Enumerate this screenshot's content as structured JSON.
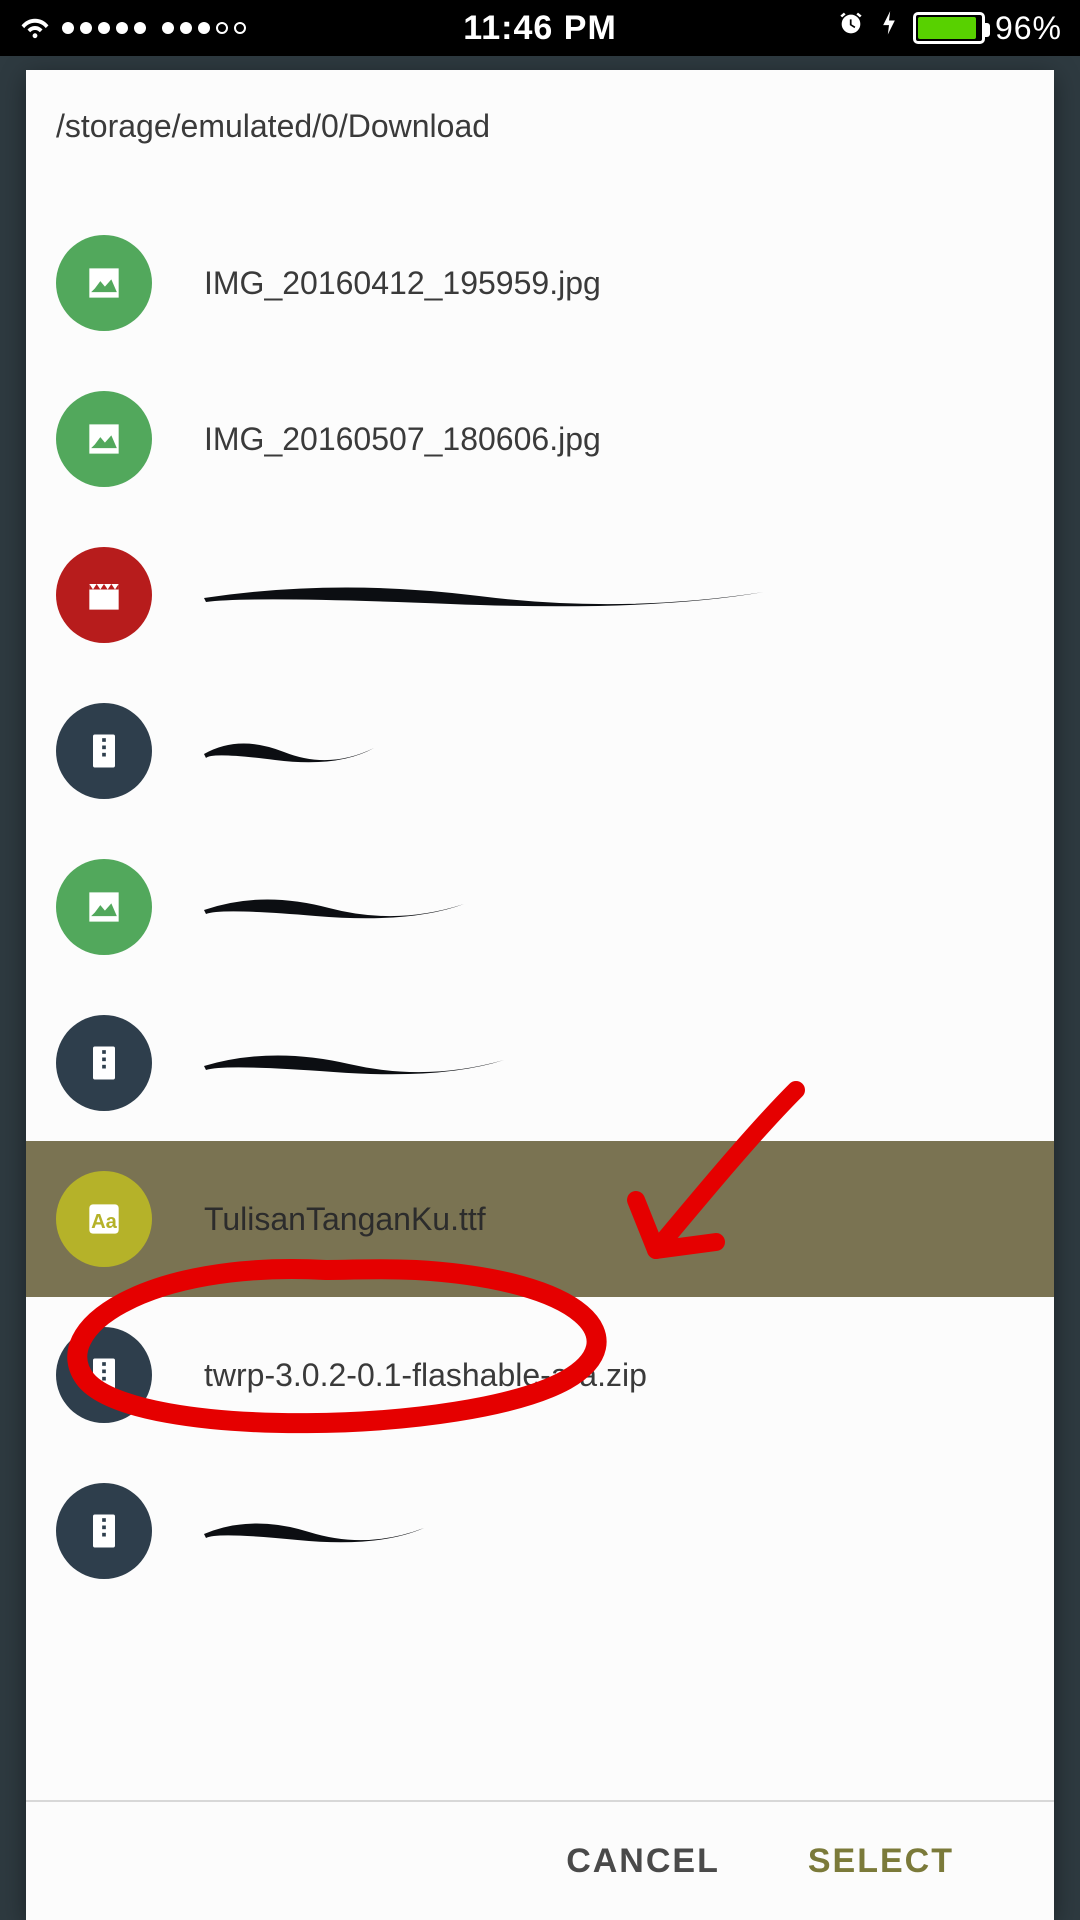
{
  "status": {
    "time": "11:46 PM",
    "battery_pct": "96%",
    "battery_level_w": 58
  },
  "modal": {
    "path": "/storage/emulated/0/Download",
    "buttons": {
      "cancel": "CANCEL",
      "select": "SELECT"
    }
  },
  "files": [
    {
      "name": "IMG_20160412_195959.jpg",
      "type": "image",
      "redacted": false,
      "selected": false
    },
    {
      "name": "IMG_20160507_180606.jpg",
      "type": "image",
      "redacted": false,
      "selected": false
    },
    {
      "name": "",
      "type": "video",
      "redacted": true,
      "redact_w": 570,
      "selected": false
    },
    {
      "name": "",
      "type": "archive",
      "redacted": true,
      "redact_w": 180,
      "selected": false
    },
    {
      "name": "",
      "type": "image",
      "redacted": true,
      "redact_w": 270,
      "selected": false
    },
    {
      "name": "",
      "type": "archive",
      "redacted": true,
      "redact_w": 310,
      "selected": false
    },
    {
      "name": "TulisanTanganKu.ttf",
      "type": "font",
      "redacted": false,
      "selected": true
    },
    {
      "name": "twrp-3.0.2-0.1-flashable-ara.zip",
      "type": "archive",
      "redacted": false,
      "selected": false
    },
    {
      "name": "",
      "type": "archive",
      "redacted": true,
      "redact_w": 230,
      "selected": false
    }
  ],
  "iconColor": {
    "image": "ic-green",
    "video": "ic-red",
    "archive": "ic-dark",
    "font": "ic-olive"
  }
}
